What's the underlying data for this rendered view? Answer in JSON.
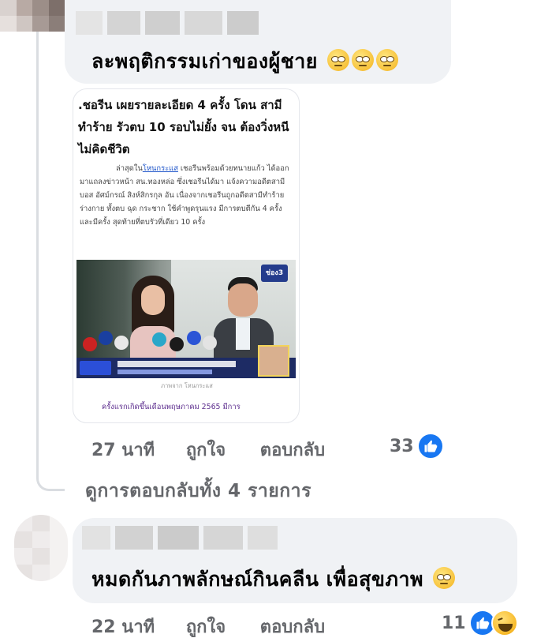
{
  "comments": [
    {
      "text": "ละพฤติกรรมเก่าของผู้ชาย",
      "emoji_count": 3,
      "timestamp": "27 นาที",
      "like_label": "ถูกใจ",
      "reply_label": "ตอบกลับ",
      "reaction_count": "33",
      "reactions": [
        "like"
      ]
    },
    {
      "text": "หมดกันภาพลักษณ์กินคลีน เพื่อสุขภาพ",
      "emoji_count": 1,
      "timestamp": "22 นาที",
      "like_label": "ถูกใจ",
      "reply_label": "ตอบกลับ",
      "reaction_count": "11",
      "reactions": [
        "like",
        "haha"
      ]
    }
  ],
  "news_card": {
    "title": ".ชอรีน เผยรายละเอียด 4 ครั้ง โดน สามีทำร้าย รัวตบ 10 รอบไม่ยั้ง จน ต้องวิ่งหนีไม่คิดชีวิต",
    "body_prefix": "ล่าสุดใน",
    "body_link": "โหนกระแส",
    "body_rest": " เชอรีนพร้อมด้วยทนายแก้ว ได้ออกมาแถลงข่าวหน้า สน.ทองหล่อ ซึ่งเชอรีนได้มา แจ้งความอดีตสามี บอส อัศม์กรณ์ สิงห์สิกรกุล อัน เนื่องจากเชอรีนถูกอดีตสามีทำร้ายร่างกาย ทั้งตบ ฉุด กระชาก ใช้คำพูดรุนแรง มีการตบตีกัน 4 ครั้ง และมีครั้ง สุดท้ายที่ตบรัวที่เดียว 10 ครั้ง",
    "photo_caption": "ภาพจาก โหนกระแส",
    "foot_text": "ครั้งแรกเกิดขึ้นเดือนพฤษภาคม 2565 มีการ",
    "channel_logo": "ช่อง3"
  },
  "view_replies_label": "ดูการตอบกลับทั้ง 4 รายการ",
  "colors": {
    "bubble": "#f0f2f5",
    "like_blue": "#1877f2",
    "meta_gray": "#65676b"
  },
  "icons": {
    "like": "thumbs-up-icon",
    "haha": "haha-emoji-icon",
    "rolling_eyes": "rolling-eyes-emoji-icon"
  }
}
